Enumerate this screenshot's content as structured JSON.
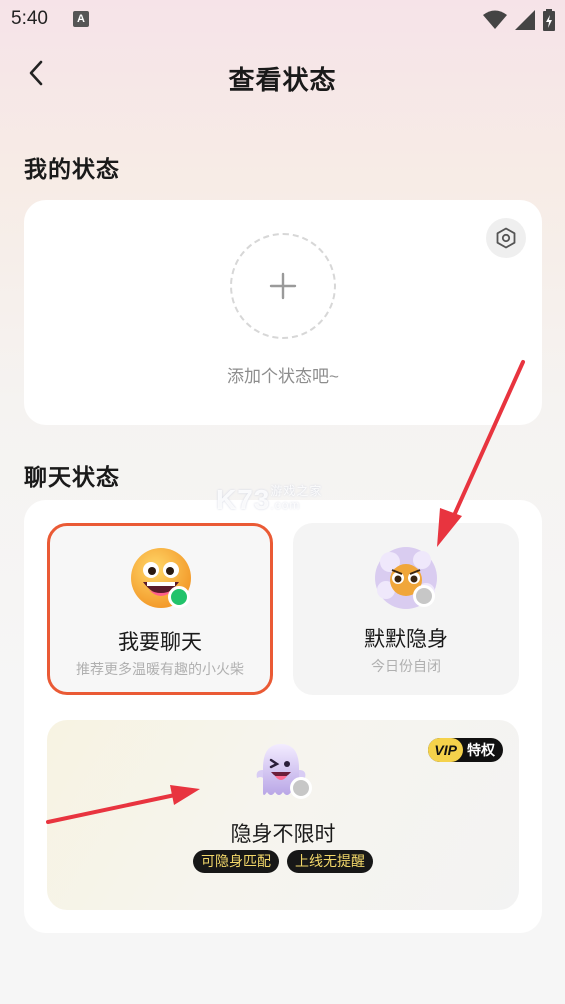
{
  "status_bar": {
    "time": "5:40",
    "a_icon": "A"
  },
  "header": {
    "title": "查看状态"
  },
  "my_status": {
    "section_title": "我的状态",
    "add_hint": "添加个状态吧~"
  },
  "chat_status": {
    "section_title": "聊天状态",
    "options": [
      {
        "title": "我要聊天",
        "subtitle": "推荐更多温暖有趣的小火柴",
        "status_color": "#22c36b"
      },
      {
        "title": "默默隐身",
        "subtitle": "今日份自闭",
        "status_color": "#c7c7c7"
      }
    ],
    "invisible": {
      "title": "隐身不限时",
      "vip_label": "VIP",
      "vip_privilege": "特权",
      "tags": [
        "可隐身匹配",
        "上线无提醒"
      ],
      "status_color": "#c7c7c7"
    }
  },
  "watermark": {
    "text": "K73",
    "sub1": "游戏之家",
    "sub2": ".com"
  },
  "colors": {
    "selected_border": "#ea5a35",
    "annotation_arrow": "#e8343f"
  }
}
